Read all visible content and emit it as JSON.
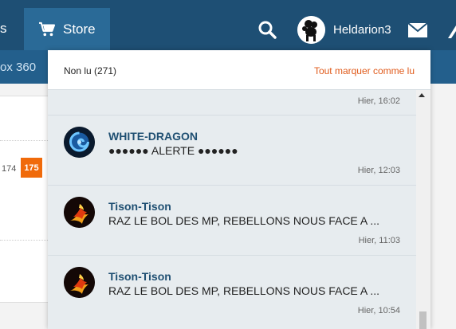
{
  "nav": {
    "left_fragment": "s",
    "store_label": "Store",
    "username": "Heldarion3",
    "icons": [
      "cart-icon",
      "search-icon",
      "mail-icon"
    ]
  },
  "subnav": {
    "fragment": "ox 360"
  },
  "pagination": {
    "prev_page": "174",
    "current_page": "175"
  },
  "colors": {
    "nav_bg": "#1e4f74",
    "store_tab_bg": "#2a6a97",
    "accent_orange": "#e05a1a",
    "author_blue": "#1f4f72",
    "dropdown_bg": "#e7ecef"
  },
  "notifications": {
    "unread_label": "Non lu (271)",
    "mark_all_label": "Tout marquer comme lu",
    "first_timestamp": "Hier, 16:02",
    "messages": [
      {
        "author": "WHITE-DRAGON",
        "body": "●●●●●● ALERTE ●●●●●●",
        "time": "Hier, 12:03",
        "avatar": "dragon-swirl-avatar"
      },
      {
        "author": "Tison-Tison",
        "body": "RAZ LE BOL DES MP, REBELLONS NOUS FACE A ...",
        "time": "Hier, 11:03",
        "avatar": "fire-avatar"
      },
      {
        "author": "Tison-Tison",
        "body": "RAZ LE BOL DES MP, REBELLONS NOUS FACE A ...",
        "time": "Hier, 10:54",
        "avatar": "fire-avatar"
      }
    ]
  }
}
